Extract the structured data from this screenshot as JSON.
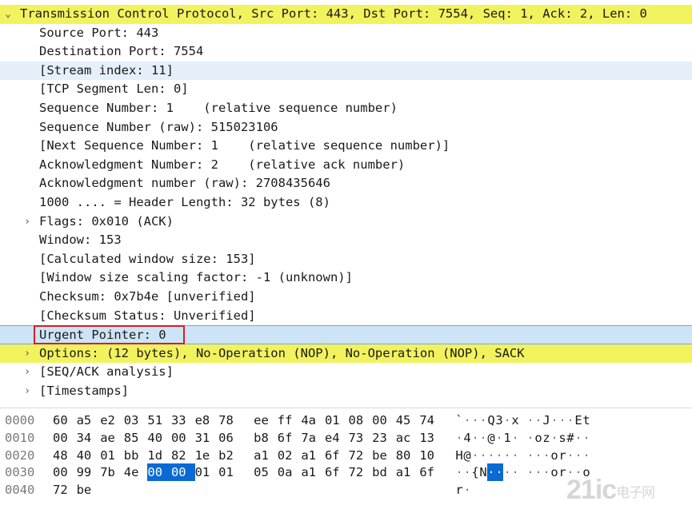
{
  "tree": {
    "rows": [
      {
        "text": "Transmission Control Protocol, Src Port: 443, Dst Port: 7554, Seq: 1, Ack: 2, Len: 0",
        "arrow": "open",
        "style": "hl-yellow"
      },
      {
        "text": "Source Port: 443"
      },
      {
        "text": "Destination Port: 7554"
      },
      {
        "text": "[Stream index: 11]",
        "style": "hl-blue"
      },
      {
        "text": "[TCP Segment Len: 0]"
      },
      {
        "text": "Sequence Number: 1    (relative sequence number)"
      },
      {
        "text": "Sequence Number (raw): 515023106"
      },
      {
        "text": "[Next Sequence Number: 1    (relative sequence number)]"
      },
      {
        "text": "Acknowledgment Number: 2    (relative ack number)"
      },
      {
        "text": "Acknowledgment number (raw): 2708435646"
      },
      {
        "text": "1000 .... = Header Length: 32 bytes (8)"
      },
      {
        "text": "Flags: 0x010 (ACK)",
        "arrow": "closed"
      },
      {
        "text": "Window: 153"
      },
      {
        "text": "[Calculated window size: 153]"
      },
      {
        "text": "[Window size scaling factor: -1 (unknown)]"
      },
      {
        "text": "Checksum: 0x7b4e [unverified]"
      },
      {
        "text": "[Checksum Status: Unverified]"
      },
      {
        "text": "Urgent Pointer: 0",
        "style": "hl-sel"
      },
      {
        "text": "Options: (12 bytes), No-Operation (NOP), No-Operation (NOP), SACK",
        "arrow": "closed",
        "style": "hl-yellow"
      },
      {
        "text": "[SEQ/ACK analysis]",
        "arrow": "closed"
      },
      {
        "text": "[Timestamps]",
        "arrow": "closed"
      }
    ]
  },
  "hex": {
    "rows": [
      {
        "offset": "0000",
        "bytes": [
          "60",
          "a5",
          "e2",
          "03",
          "51",
          "33",
          "e8",
          "78",
          "ee",
          "ff",
          "4a",
          "01",
          "08",
          "00",
          "45",
          "74"
        ],
        "ascii": [
          "`",
          "·",
          "·",
          "·",
          "Q",
          "3",
          "·",
          "x",
          "·",
          "·",
          "J",
          "·",
          "·",
          "·",
          "E",
          "t"
        ]
      },
      {
        "offset": "0010",
        "bytes": [
          "00",
          "34",
          "ae",
          "85",
          "40",
          "00",
          "31",
          "06",
          "b8",
          "6f",
          "7a",
          "e4",
          "73",
          "23",
          "ac",
          "13"
        ],
        "ascii": [
          "·",
          "4",
          "·",
          "·",
          "@",
          "·",
          "1",
          "·",
          "·",
          "o",
          "z",
          "·",
          "s",
          "#",
          "·",
          "·"
        ]
      },
      {
        "offset": "0020",
        "bytes": [
          "48",
          "40",
          "01",
          "bb",
          "1d",
          "82",
          "1e",
          "b2",
          "a1",
          "02",
          "a1",
          "6f",
          "72",
          "be",
          "80",
          "10"
        ],
        "ascii": [
          "H",
          "@",
          "·",
          "·",
          "·",
          "·",
          "·",
          "·",
          "·",
          "·",
          "·",
          "o",
          "r",
          "·",
          "·",
          "·"
        ]
      },
      {
        "offset": "0030",
        "bytes": [
          "00",
          "99",
          "7b",
          "4e",
          "00",
          "00",
          "01",
          "01",
          "05",
          "0a",
          "a1",
          "6f",
          "72",
          "bd",
          "a1",
          "6f"
        ],
        "ascii": [
          "·",
          "·",
          "{",
          "N",
          "·",
          "·",
          "·",
          "·",
          "·",
          "·",
          "·",
          "o",
          "r",
          "·",
          "·",
          "o"
        ],
        "selected": [
          4,
          5
        ]
      },
      {
        "offset": "0040",
        "bytes": [
          "72",
          "be"
        ],
        "ascii": [
          "r",
          "·"
        ]
      }
    ]
  },
  "icons": {
    "expanded": "chevron-down-icon",
    "collapsed": "chevron-right-icon"
  },
  "colors": {
    "field_highlight": "#f2f25e",
    "selection": "#0a6ad4",
    "annotation_box": "#d0202a"
  },
  "watermark": {
    "main": "21ic",
    "sub": "电子网"
  }
}
